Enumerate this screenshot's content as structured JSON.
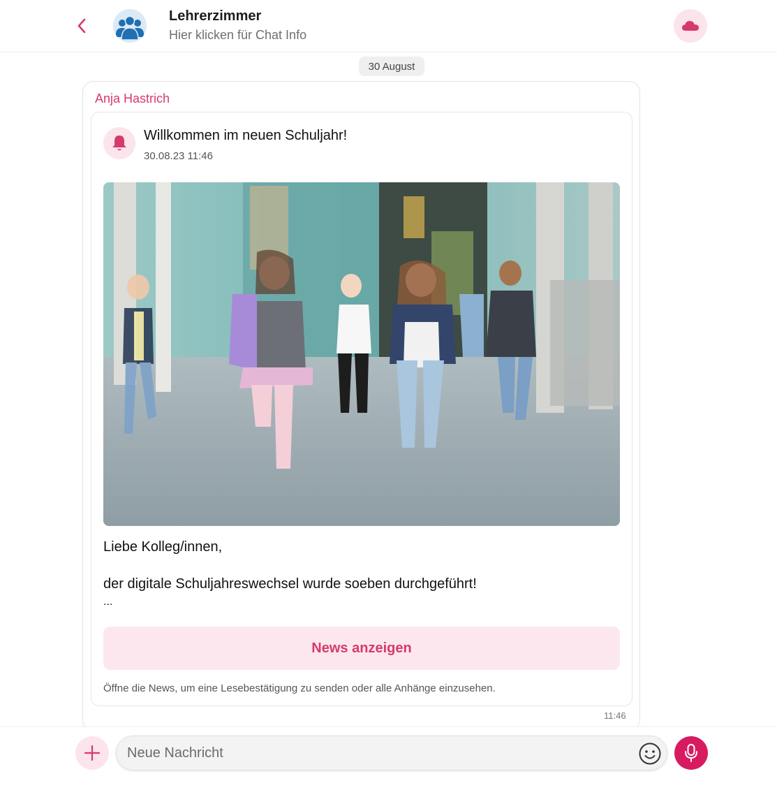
{
  "header": {
    "back_icon": "chevron-left-icon",
    "avatar_icon": "group-icon",
    "title": "Lehrerzimmer",
    "subtitle": "Hier klicken für Chat Info",
    "cloud_icon": "cloud-icon"
  },
  "chat": {
    "date_separator": "30 August",
    "message": {
      "sender": "Anja Hastrich",
      "time": "11:46",
      "news": {
        "icon": "bell-icon",
        "title": "Willkommen im neuen Schuljahr!",
        "date": "30.08.23 11:46",
        "image_description": "children-running-in-school-hallway-photo",
        "greeting": "Liebe Kolleg/innen,",
        "body": "der digitale Schuljahreswechsel wurde soeben durchgeführt!",
        "ellipsis": "...",
        "button_label": "News anzeigen",
        "hint": "Öffne die News, um eine Lesebestätigung zu senden oder alle Anhänge einzusehen."
      }
    }
  },
  "composer": {
    "add_icon": "plus-icon",
    "placeholder": "Neue Nachricht",
    "emoji_icon": "emoji-icon",
    "mic_icon": "microphone-icon"
  },
  "colors": {
    "accent": "#d63a6a",
    "accent_light": "#fce4ec",
    "mic": "#d81b60",
    "avatar": "#1f6fb2"
  }
}
